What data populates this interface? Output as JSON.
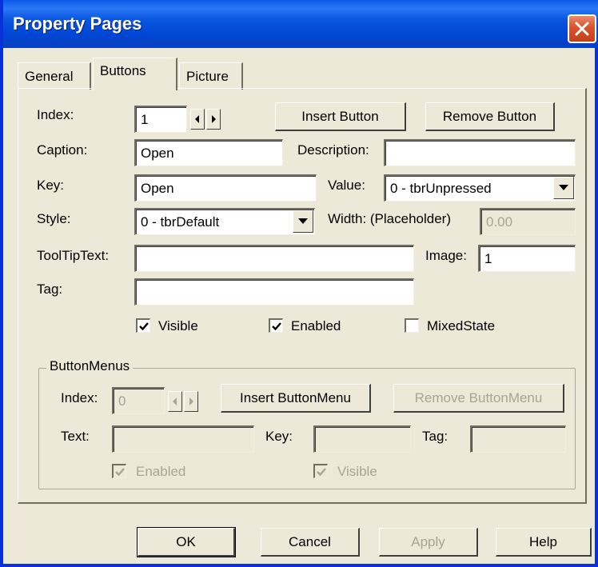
{
  "window": {
    "title": "Property Pages"
  },
  "tabs": [
    "General",
    "Buttons",
    "Picture"
  ],
  "form": {
    "index_label": "Index:",
    "index_value": "1",
    "insert_button": "Insert Button",
    "remove_button": "Remove Button",
    "caption_label": "Caption:",
    "caption_value": "Open",
    "description_label": "Description:",
    "description_value": "",
    "key_label": "Key:",
    "key_value": "Open",
    "value_label": "Value:",
    "value_selected": "0 - tbrUnpressed",
    "style_label": "Style:",
    "style_selected": "0 - tbrDefault",
    "width_label": "Width: (Placeholder)",
    "width_value": "0.00",
    "tooltip_label": "ToolTipText:",
    "tooltip_value": "",
    "image_label": "Image:",
    "image_value": "1",
    "tag_label": "Tag:",
    "tag_value": "",
    "visible_label": "Visible",
    "visible_checked": true,
    "enabled_label": "Enabled",
    "enabled_checked": true,
    "mixed_label": "MixedState",
    "mixed_checked": false
  },
  "buttonmenus": {
    "group_title": "ButtonMenus",
    "index_label": "Index:",
    "index_value": "0",
    "insert_label": "Insert ButtonMenu",
    "remove_label": "Remove ButtonMenu",
    "text_label": "Text:",
    "key_label": "Key:",
    "tag_label": "Tag:",
    "enabled_label": "Enabled",
    "visible_label": "Visible"
  },
  "footer": {
    "ok": "OK",
    "cancel": "Cancel",
    "apply": "Apply",
    "help": "Help"
  },
  "colors": {
    "titlebar": "#0a56e0",
    "dialog_bg": "#ece9d8",
    "close": "#d9532b",
    "disabled_text": "#a8a596"
  }
}
